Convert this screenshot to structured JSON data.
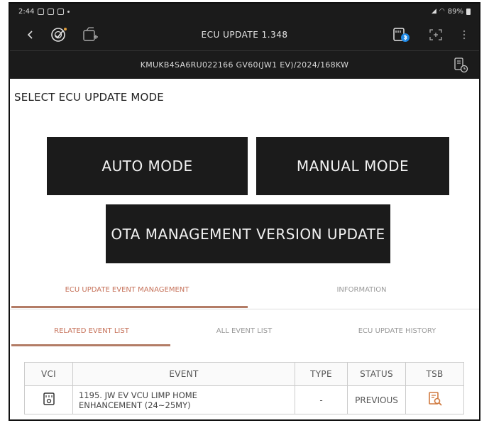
{
  "status_bar": {
    "time": "2:44",
    "battery": "89%"
  },
  "header": {
    "title": "ECU UPDATE 1.348",
    "vehicle_info": "KMUKB4SA6RU022166  GV60(JW1 EV)/2024/168KW"
  },
  "section_title": "SELECT ECU UPDATE MODE",
  "modes": {
    "auto": "AUTO MODE",
    "manual": "MANUAL MODE",
    "ota": "OTA MANAGEMENT VERSION UPDATE"
  },
  "main_tabs": [
    {
      "label": "ECU UPDATE EVENT MANAGEMENT",
      "active": true
    },
    {
      "label": "INFORMATION",
      "active": false
    }
  ],
  "sub_tabs": [
    {
      "label": "RELATED EVENT LIST",
      "active": true
    },
    {
      "label": "ALL EVENT LIST",
      "active": false
    },
    {
      "label": "ECU UPDATE HISTORY",
      "active": false
    }
  ],
  "table": {
    "columns": [
      "VCI",
      "EVENT",
      "TYPE",
      "STATUS",
      "TSB"
    ],
    "rows": [
      {
        "event_line1": "1195. JW EV VCU LIMP HOME",
        "event_line2": "ENHANCEMENT (24~25MY)",
        "type": "-",
        "status": "PREVIOUS"
      }
    ]
  },
  "colors": {
    "bar": "#1b1b1b",
    "accent": "#b37c66",
    "tsb_icon": "#d07a40"
  }
}
